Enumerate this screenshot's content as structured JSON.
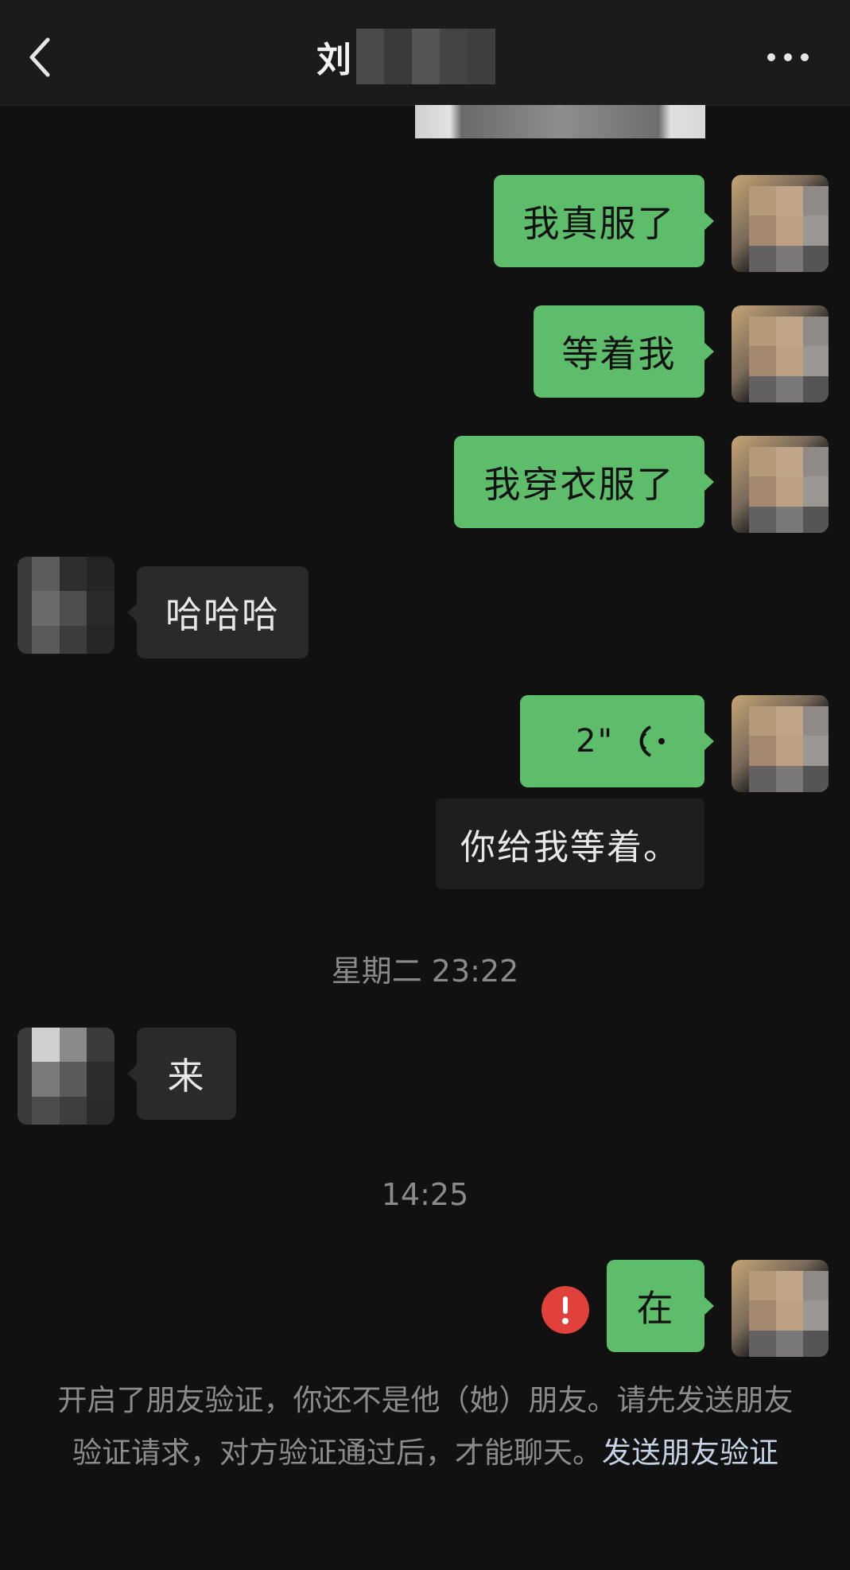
{
  "nav": {
    "title": "刘",
    "back_icon": "chevron-left-icon",
    "more_icon": "more-horizontal-icon"
  },
  "messages": [
    {
      "side": "sent",
      "text": "我真服了"
    },
    {
      "side": "sent",
      "text": "等着我"
    },
    {
      "side": "sent",
      "text": "我穿衣服了"
    },
    {
      "side": "received",
      "text": "哈哈哈"
    },
    {
      "side": "sent",
      "type": "voice",
      "duration": "2\""
    },
    {
      "side": "transcript",
      "text": "你给我等着。"
    },
    {
      "side": "received",
      "text": "来"
    },
    {
      "side": "sent",
      "text": "在",
      "status": "failed"
    }
  ],
  "timestamps": [
    "星期二 23:22",
    "14:25"
  ],
  "notice": {
    "text": "开启了朋友验证，你还不是他（她）朋友。请先发送朋友验证请求，对方验证通过后，才能聊天。",
    "link": "发送朋友验证"
  },
  "colors": {
    "background": "#111111",
    "sent_bubble": "#5dbd6a",
    "received_bubble": "#2a2a2a",
    "error_red": "#e0413a",
    "link": "#c6d3e6"
  }
}
